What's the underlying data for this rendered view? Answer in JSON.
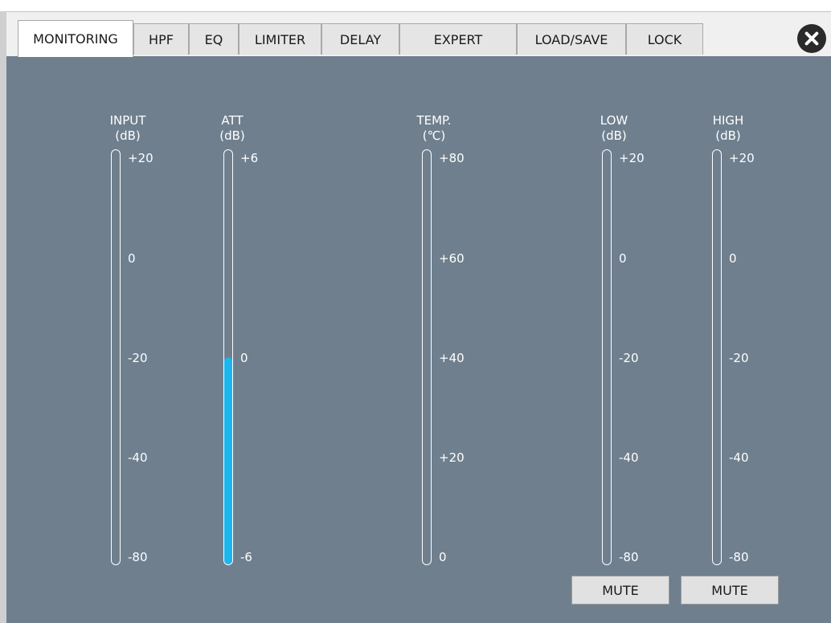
{
  "tabs": [
    {
      "label": "MONITORING",
      "active": true
    },
    {
      "label": "HPF"
    },
    {
      "label": "EQ"
    },
    {
      "label": "LIMITER"
    },
    {
      "label": "DELAY"
    },
    {
      "label": "EXPERT"
    },
    {
      "label": "LOAD/SAVE"
    },
    {
      "label": "LOCK"
    }
  ],
  "close_icon": "close-circle-icon",
  "meters": [
    {
      "id": "input",
      "title": "INPUT",
      "unit": "(dB)",
      "ticks": [
        "+20",
        "0",
        "-20",
        "-40",
        "-80"
      ],
      "level": 0
    },
    {
      "id": "att",
      "title": "ATT",
      "unit": "(dB)",
      "ticks": [
        "+6",
        "",
        "0",
        "",
        "-6"
      ],
      "level": 0.5
    },
    {
      "id": "temp",
      "title": "TEMP.",
      "unit": "(℃)",
      "ticks": [
        "+80",
        "+60",
        "+40",
        "+20",
        "0"
      ],
      "level": 0
    },
    {
      "id": "low",
      "title": "LOW",
      "unit": "(dB)",
      "ticks": [
        "+20",
        "0",
        "-20",
        "-40",
        "-80"
      ],
      "level": 0
    },
    {
      "id": "high",
      "title": "HIGH",
      "unit": "(dB)",
      "ticks": [
        "+20",
        "0",
        "-20",
        "-40",
        "-80"
      ],
      "level": 0
    }
  ],
  "mute_buttons": [
    {
      "label": "MUTE"
    },
    {
      "label": "MUTE"
    }
  ],
  "colors": {
    "panel": "#6f7f8e",
    "meter_fill": "#1bb5ef"
  }
}
